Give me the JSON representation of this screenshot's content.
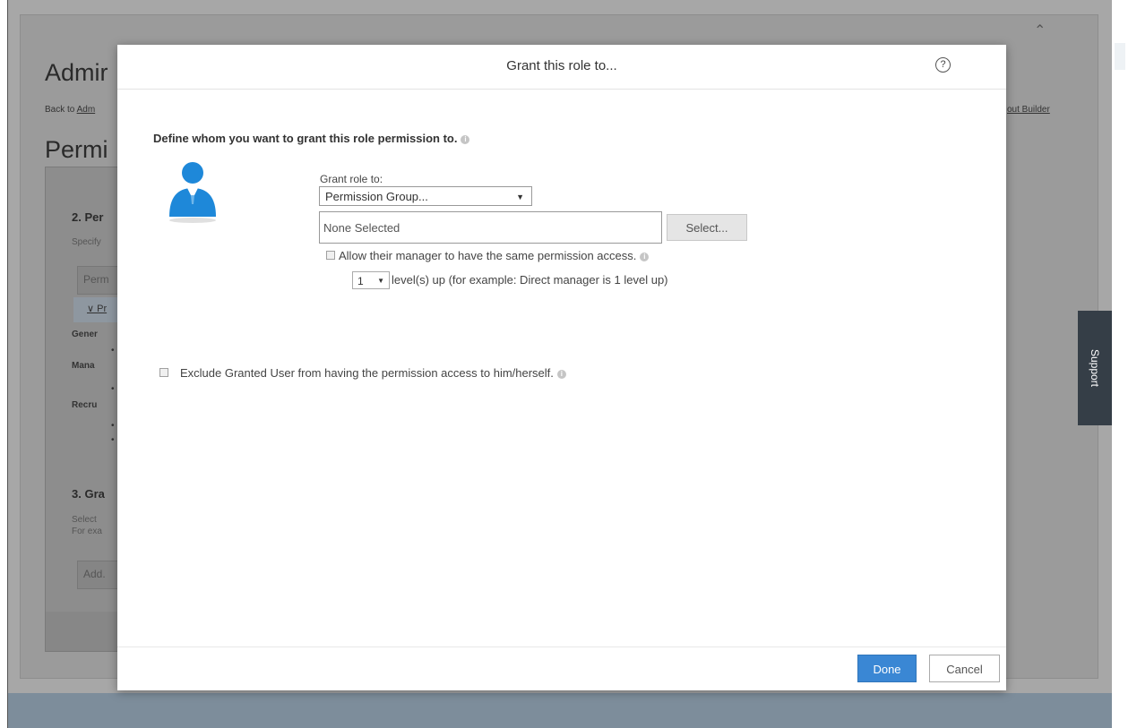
{
  "background": {
    "admin_title": "Admir",
    "back_prefix": "Back to",
    "back_link": "Adm",
    "builder_link": "out Builder",
    "perm_title": "Permi",
    "section2": "2. Per",
    "specify": "Specify",
    "perm_button": "Perm",
    "tree_item": "∨ Pr",
    "general": "Gener",
    "manage": "Mana",
    "recruit": "Recru",
    "section3": "3. Gra",
    "select_text": "Select",
    "for_example": "For exa",
    "add_button": "Add.",
    "support_tab": "Support"
  },
  "modal": {
    "title": "Grant this role to...",
    "help_glyph": "?",
    "define_text": "Define whom you want to grant this role permission to.",
    "info_glyph": "i",
    "grant_label": "Grant role to:",
    "grant_select_value": "Permission Group...",
    "selection_input_value": "None Selected",
    "select_button": "Select...",
    "allow_manager_text": "Allow their manager to have the same permission access.",
    "level_value": "1",
    "level_text": "level(s) up (for example: Direct manager is 1 level up)",
    "exclude_text": "Exclude Granted User from having the permission access to him/herself.",
    "done_button": "Done",
    "cancel_button": "Cancel"
  },
  "colors": {
    "primary_button": "#3a87d4",
    "overlay": "#a7a7a7",
    "support_tab": "#353e47",
    "avatar_blue": "#1e88d9"
  },
  "icons": [
    "help-circle-icon",
    "user-avatar-icon",
    "info-icon",
    "chevron-up-icon",
    "dropdown-arrow-icon"
  ]
}
